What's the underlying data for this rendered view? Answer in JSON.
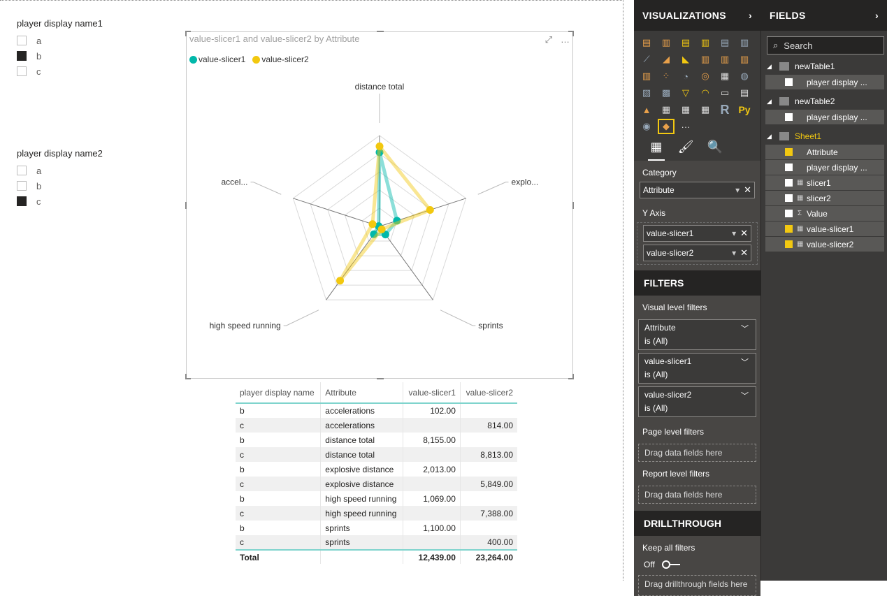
{
  "slicers": [
    {
      "title": "player display name1",
      "items": [
        {
          "label": "a",
          "checked": false
        },
        {
          "label": "b",
          "checked": true
        },
        {
          "label": "c",
          "checked": false
        }
      ]
    },
    {
      "title": "player display name2",
      "items": [
        {
          "label": "a",
          "checked": false
        },
        {
          "label": "b",
          "checked": false
        },
        {
          "label": "c",
          "checked": true
        }
      ]
    }
  ],
  "radar": {
    "title": "value-slicer1 and value-slicer2 by Attribute",
    "focus_icon": "focus-mode-icon",
    "more_icon": "…",
    "legend": [
      {
        "name": "value-slicer1",
        "color": "#01b8aa"
      },
      {
        "name": "value-slicer2",
        "color": "#f2c80f"
      }
    ],
    "axis_labels": [
      "distance total",
      "explo...",
      "sprints",
      "high speed running",
      "accel..."
    ]
  },
  "chart_data": {
    "type": "radar",
    "title": "value-slicer1 and value-slicer2 by Attribute",
    "categories": [
      "distance total",
      "explosive distance",
      "sprints",
      "high speed running",
      "accelerations"
    ],
    "series": [
      {
        "name": "value-slicer1",
        "color": "#01b8aa",
        "values": [
          8155,
          2013,
          1100,
          1069,
          102
        ]
      },
      {
        "name": "value-slicer2",
        "color": "#f2c80f",
        "values": [
          8813,
          5849,
          400,
          7388,
          814
        ]
      }
    ],
    "max": 10000,
    "legend": "top-left"
  },
  "table": {
    "headers": [
      "player display name",
      "Attribute",
      "value-slicer1",
      "value-slicer2"
    ],
    "rows": [
      [
        "b",
        "accelerations",
        "102.00",
        ""
      ],
      [
        "c",
        "accelerations",
        "",
        "814.00"
      ],
      [
        "b",
        "distance total",
        "8,155.00",
        ""
      ],
      [
        "c",
        "distance total",
        "",
        "8,813.00"
      ],
      [
        "b",
        "explosive distance",
        "2,013.00",
        ""
      ],
      [
        "c",
        "explosive distance",
        "",
        "5,849.00"
      ],
      [
        "b",
        "high speed running",
        "1,069.00",
        ""
      ],
      [
        "c",
        "high speed running",
        "",
        "7,388.00"
      ],
      [
        "b",
        "sprints",
        "1,100.00",
        ""
      ],
      [
        "c",
        "sprints",
        "",
        "400.00"
      ]
    ],
    "total": [
      "Total",
      "",
      "12,439.00",
      "23,264.00"
    ]
  },
  "viz_pane": {
    "title": "VISUALIZATIONS",
    "category_label": "Category",
    "category_field": "Attribute",
    "yaxis_label": "Y Axis",
    "yaxis_fields": [
      "value-slicer1",
      "value-slicer2"
    ],
    "filters_title": "FILTERS",
    "visual_filters_label": "Visual level filters",
    "visual_filters": [
      {
        "name": "Attribute",
        "state": "is (All)"
      },
      {
        "name": "value-slicer1",
        "state": "is (All)"
      },
      {
        "name": "value-slicer2",
        "state": "is (All)"
      }
    ],
    "page_filters_label": "Page level filters",
    "report_filters_label": "Report level filters",
    "drop_hint": "Drag data fields here",
    "drillthrough_title": "DRILLTHROUGH",
    "keep_filters_label": "Keep all filters",
    "toggle_state": "Off",
    "drill_hint": "Drag drillthrough fields here",
    "r_label": "R",
    "py_label": "Py",
    "more_label": "···"
  },
  "fields_pane": {
    "title": "FIELDS",
    "search_placeholder": "Search",
    "tables": [
      {
        "name": "newTable1",
        "active": false,
        "fields": [
          {
            "name": "player display ...",
            "checked": false,
            "icon": ""
          }
        ]
      },
      {
        "name": "newTable2",
        "active": false,
        "fields": [
          {
            "name": "player display ...",
            "checked": false,
            "icon": ""
          }
        ]
      },
      {
        "name": "Sheet1",
        "active": true,
        "fields": [
          {
            "name": "Attribute",
            "checked": true,
            "icon": ""
          },
          {
            "name": "player display ...",
            "checked": false,
            "icon": ""
          },
          {
            "name": "slicer1",
            "checked": false,
            "icon": "calc"
          },
          {
            "name": "slicer2",
            "checked": false,
            "icon": "calc"
          },
          {
            "name": "Value",
            "checked": false,
            "icon": "sigma"
          },
          {
            "name": "value-slicer1",
            "checked": true,
            "icon": "calc"
          },
          {
            "name": "value-slicer2",
            "checked": true,
            "icon": "calc"
          }
        ]
      }
    ]
  }
}
